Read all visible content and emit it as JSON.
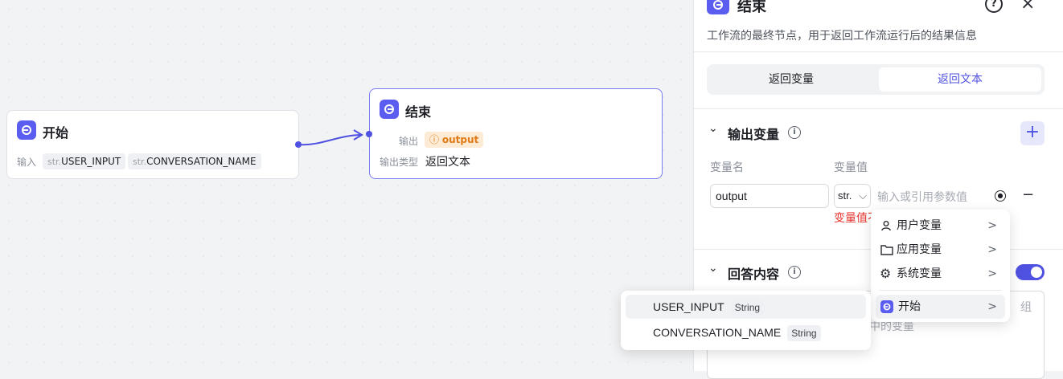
{
  "canvas": {
    "start_node": {
      "title": "开始",
      "input_label": "输入",
      "inputs": [
        {
          "type": "str.",
          "name": "USER_INPUT"
        },
        {
          "type": "str.",
          "name": "CONVERSATION_NAME"
        }
      ]
    },
    "end_node": {
      "title": "结束",
      "output_label": "输出",
      "output_value": "output",
      "output_type_label": "输出类型",
      "output_type_value": "返回文本"
    }
  },
  "panel": {
    "title": "结束",
    "description": "工作流的最终节点，用于返回工作流运行后的结果信息",
    "tabs": [
      "返回变量",
      "返回文本"
    ],
    "active_tab": "返回文本",
    "output_section": {
      "title": "输出变量",
      "col_name": "变量名",
      "col_value": "变量值",
      "row": {
        "name": "output",
        "type_prefix": "str.",
        "value_placeholder": "输入或引用参数值",
        "error_text": "变量值不"
      }
    },
    "answer_section": {
      "title": "回答内容",
      "toggle_on": true,
      "hint_right": "组",
      "hint_text": "中的变量"
    }
  },
  "var_menu": {
    "items": [
      {
        "label": "用户变量",
        "icon": "user-icon"
      },
      {
        "label": "应用变量",
        "icon": "folder-icon"
      },
      {
        "label": "系统变量",
        "icon": "gear-icon"
      },
      {
        "label": "开始",
        "icon": "start-node-icon"
      }
    ]
  },
  "start_submenu": {
    "items": [
      {
        "name": "USER_INPUT",
        "type": "String"
      },
      {
        "name": "CONVERSATION_NAME",
        "type": "String"
      }
    ]
  },
  "colors": {
    "accent": "#5b5cf0",
    "error": "#e5322c",
    "warning_bg": "#fdebd6",
    "warning_text": "#e07a14"
  }
}
